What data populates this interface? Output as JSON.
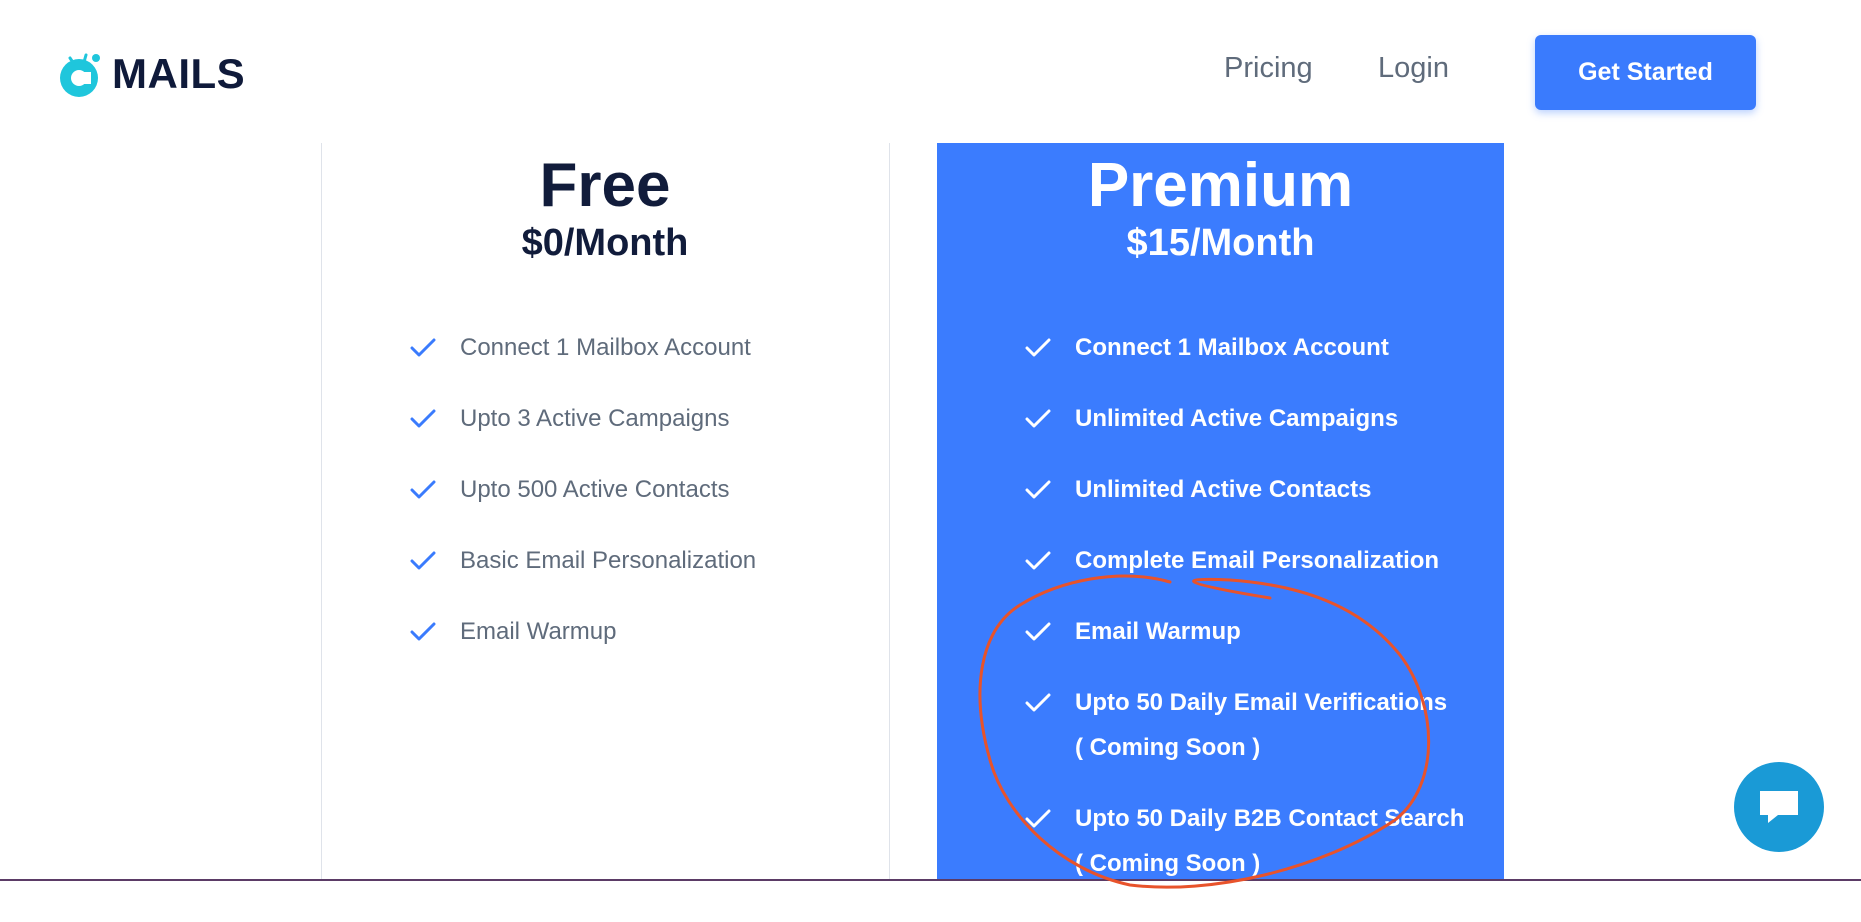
{
  "brand": {
    "name": "MAILS",
    "logo_icon": "mails-logo-icon",
    "accent": "#3a7bfd"
  },
  "nav": {
    "pricing": "Pricing",
    "login": "Login",
    "cta": "Get Started"
  },
  "plans": {
    "free": {
      "title": "Free",
      "price": "$0/Month",
      "features": [
        "Connect 1 Mailbox Account",
        "Upto 3 Active Campaigns",
        "Upto 500 Active Contacts",
        "Basic Email Personalization",
        "Email Warmup"
      ]
    },
    "premium": {
      "title": "Premium",
      "price": "$15/Month",
      "background": "#3b7cfe",
      "features": [
        {
          "text": "Connect 1 Mailbox Account",
          "note": ""
        },
        {
          "text": "Unlimited Active Campaigns",
          "note": ""
        },
        {
          "text": "Unlimited Active Contacts",
          "note": ""
        },
        {
          "text": "Complete Email Personalization",
          "note": ""
        },
        {
          "text": "Email Warmup",
          "note": ""
        },
        {
          "text": "Upto 50 Daily Email Verifications",
          "note": "( Coming Soon )"
        },
        {
          "text": "Upto 50 Daily B2B Contact Search",
          "note": "( Coming Soon )"
        }
      ]
    }
  },
  "chat": {
    "icon": "chat-bubble-icon",
    "color": "#1a9ad6"
  },
  "annotation": {
    "color": "#e8532b",
    "shape": "hand-drawn-circle"
  }
}
